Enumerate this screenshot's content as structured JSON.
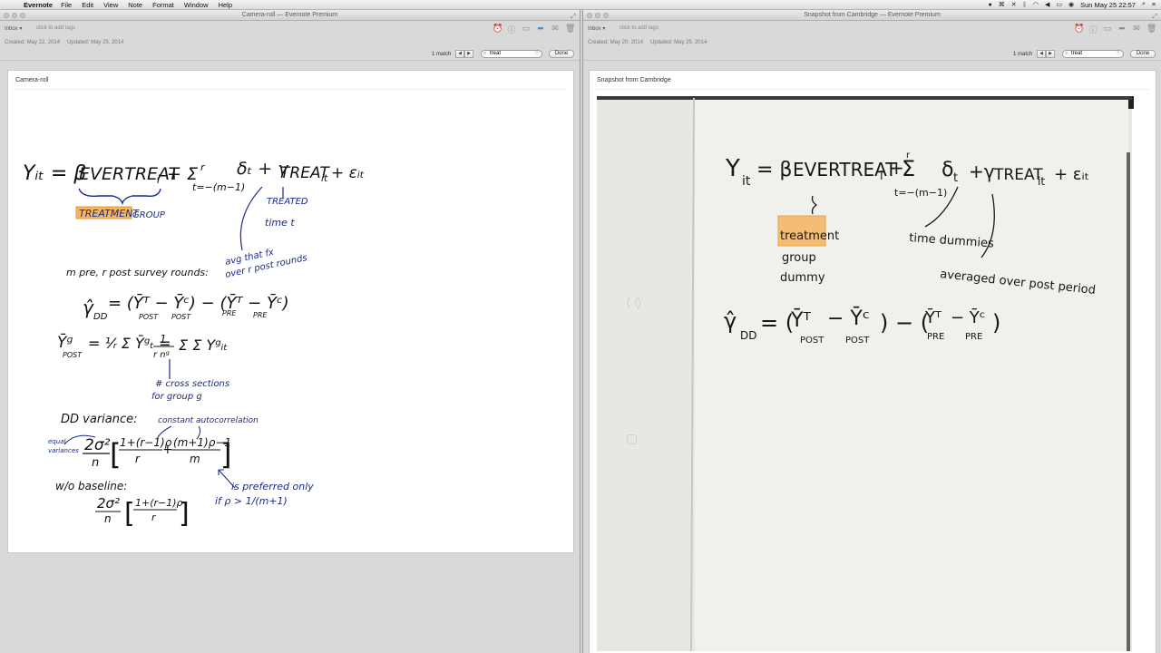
{
  "menubar": {
    "app_name": "Evernote",
    "menus": [
      "File",
      "Edit",
      "View",
      "Note",
      "Format",
      "Window",
      "Help"
    ],
    "clock": "Sun May 25  22:57",
    "status_icons": [
      "record-icon",
      "cmd-icon",
      "x-icon",
      "bluetooth-icon",
      "wifi-icon",
      "volume-icon",
      "battery-icon",
      "user-icon",
      "spotlight-icon",
      "list-icon"
    ]
  },
  "left_window": {
    "title": "Camera-roll — Evernote Premium",
    "notebook": "Inbox",
    "tags_placeholder": "click to add tags",
    "created": "Created: May 22, 2014",
    "updated": "Updated: May 25, 2014",
    "find": {
      "count": "1 match",
      "query": "treat",
      "done_label": "Done"
    },
    "note_title": "Camera-roll",
    "handwriting": {
      "eq1": "Y_it = β EVERTREAT_i + Σ_{t=-(m-1)}^{r} δ_t + γ TREAT_it + ε_it",
      "eq1_hl": "TREATMENT",
      "eq1_group": "GROUP",
      "treated_note": "TREATED @ time t",
      "avg_note_1": "avg that fx",
      "avg_note_2": "over r post rounds",
      "rounds_note": "m pre, r post survey rounds:",
      "dd_estimator": "γ̂_DD = (Ȳ^T_POST − Ȳ^C_POST) − (Ȳ^T_PRE − Ȳ^C_PRE)",
      "ybar_eq": "Ȳ^g_POST = 1/r Σ Ȳ^g_t = 1/(r n_g) Σ Σ Y^g_it",
      "cs_note_1": "# cross sections",
      "cs_note_2": "for group g",
      "dd_variance": "DD variance:",
      "autocorr_note": "constant autocorrelation",
      "equal_note_1": "equal",
      "equal_note_2": "variances",
      "variance_formula": "2σ²/n [ (1+(r−1)ρ)/r + ((m+1)ρ−1)/m ]",
      "wo_baseline": "w/o baseline:",
      "baseline_formula": "2σ²/n [ (1+(r−1)ρ)/r ]",
      "preferred_1": "is preferred only",
      "preferred_2": "if ρ > 1/(m+1)"
    }
  },
  "right_window": {
    "title": "Snapshot from Cambridge — Evernote Premium",
    "notebook": "Inbox",
    "tags_placeholder": "click to add tags",
    "created": "Created: May 20, 2014",
    "updated": "Updated: May 25, 2014",
    "find": {
      "count": "1 match",
      "query": "treat",
      "done_label": "Done"
    },
    "note_title": "Snapshot from Cambridge",
    "photo": {
      "eq1": "Y_it = β EVERTREAT_i + Σ_{t=-(m-1)}^{r} δ_t + γ TREAT_it + ε_it",
      "hl_word": "treatment",
      "group_1": "group",
      "group_2": "dummy",
      "time_dummies": "time dummies",
      "averaged": "averaged over post period",
      "dd_estimator": "γ̂_DD = (Ȳ^T_POST − Ȳ^C_POST) − (Ȳ^T_PRE − Ȳ^C_PRE)"
    }
  },
  "colors": {
    "ink_black": "#111111",
    "ink_blue": "#1a2a8c",
    "highlight": "#f5b561",
    "highlight_border": "#e39a2c",
    "paper": "#f1f0ec",
    "accent_blue": "#3e8bd6"
  }
}
